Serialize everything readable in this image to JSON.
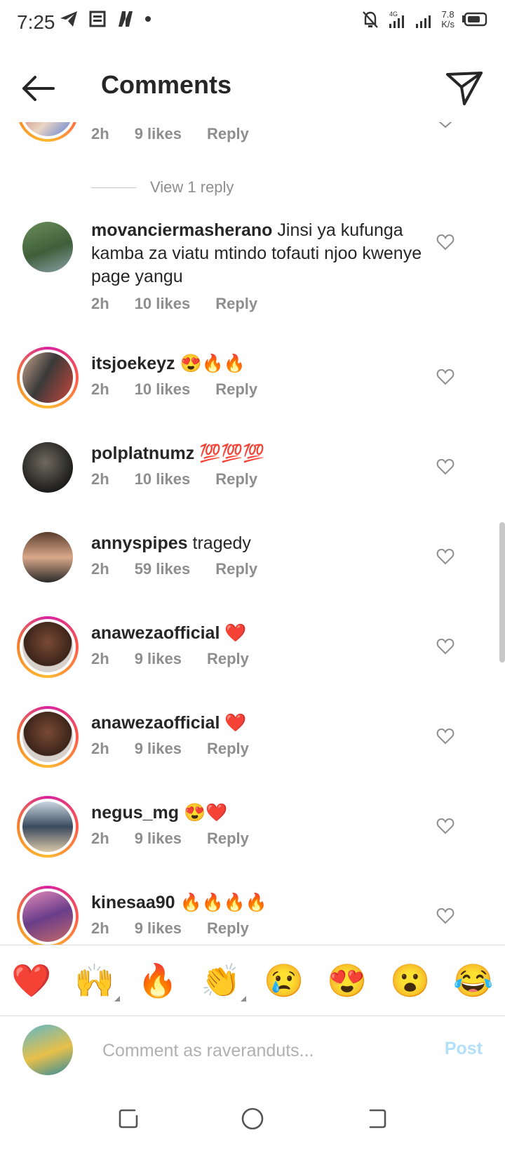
{
  "status_bar": {
    "time": "7:25",
    "network": "4G",
    "speed_value": "7.8",
    "speed_unit": "K/s"
  },
  "header": {
    "title": "Comments"
  },
  "partial_top": {
    "time": "2h",
    "likes": "9 likes",
    "reply": "Reply"
  },
  "view_replies": "View 1 reply",
  "comments": [
    {
      "username": "movanciermasherano",
      "text": "Jinsi ya kufunga kamba za viatu mtindo tofauti njoo kwenye page yangu",
      "time": "2h",
      "likes": "10 likes",
      "reply": "Reply"
    },
    {
      "username": "itsjoekeyz",
      "text": "😍🔥🔥",
      "time": "2h",
      "likes": "10 likes",
      "reply": "Reply"
    },
    {
      "username": "polplatnumz",
      "text": "💯💯💯",
      "time": "2h",
      "likes": "10 likes",
      "reply": "Reply"
    },
    {
      "username": "annyspipes",
      "text": "tragedy",
      "time": "2h",
      "likes": "59 likes",
      "reply": "Reply"
    },
    {
      "username": "anawezaofficial",
      "text": "❤️",
      "time": "2h",
      "likes": "9 likes",
      "reply": "Reply"
    },
    {
      "username": "anawezaofficial",
      "text": "❤️",
      "time": "2h",
      "likes": "9 likes",
      "reply": "Reply"
    },
    {
      "username": "negus_mg",
      "text": "😍❤️",
      "time": "2h",
      "likes": "9 likes",
      "reply": "Reply"
    },
    {
      "username": "kinesaa90",
      "text": "🔥🔥🔥🔥",
      "time": "2h",
      "likes": "9 likes",
      "reply": "Reply"
    }
  ],
  "emoji_bar": [
    "❤️",
    "🙌",
    "🔥",
    "👏",
    "😢",
    "😍",
    "😮",
    "😂"
  ],
  "composer": {
    "placeholder": "Comment as raveranduts...",
    "post_label": "Post"
  },
  "colors": {
    "accent_disabled": "#b2dffc",
    "meta_gray": "#8e8e8e",
    "text": "#262626"
  }
}
